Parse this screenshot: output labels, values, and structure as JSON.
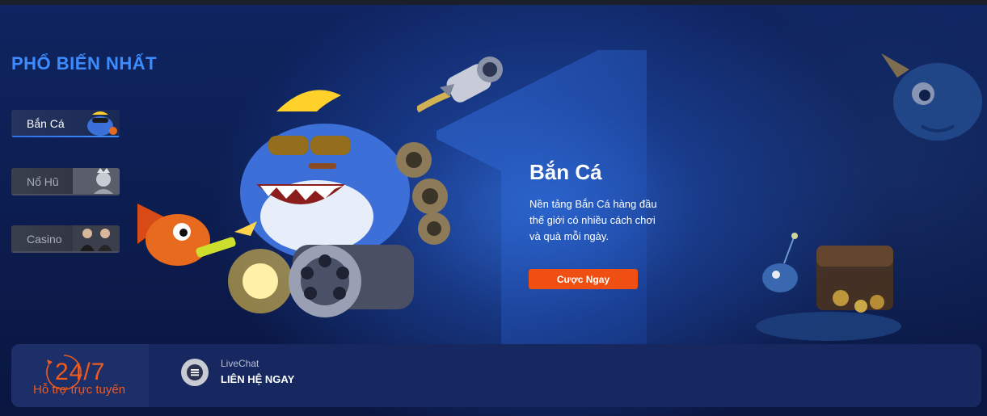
{
  "section": {
    "title": "PHỔ BIẾN NHẤT"
  },
  "categories": [
    {
      "label": "Bắn Cá",
      "active": true
    },
    {
      "label": "Nổ Hũ",
      "active": false
    },
    {
      "label": "Casino",
      "active": false
    }
  ],
  "promo": {
    "title": "Bắn Cá",
    "description": "Nền tảng Bắn Cá hàng đầu thế giới có nhiều cách chơi và quà mỗi ngày.",
    "button_label": "Cược Ngay"
  },
  "support": {
    "hours": "24/7",
    "subtitle": "Hỗ trợ trực tuyến",
    "chat_label": "LiveChat",
    "chat_action": "LIÊN HỆ NGAY"
  },
  "colors": {
    "accent_blue": "#3d8cff",
    "cta_orange": "#ef4f12",
    "support_orange": "#ef5a1e"
  }
}
